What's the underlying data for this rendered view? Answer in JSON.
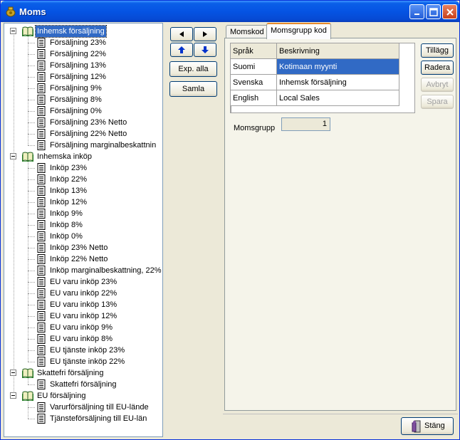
{
  "window": {
    "title": "Moms",
    "icon": "money-bag-icon"
  },
  "tree": {
    "groups": [
      {
        "label": "Inhemsk försäljning",
        "selected": true,
        "items": [
          "Försäljning 23%",
          "Försäljning 22%",
          "Försäljning 13%",
          "Försäljning 12%",
          "Försäljning 9%",
          "Försäljning 8%",
          "Försäljning 0%",
          "Försäljning 23% Netto",
          "Försäljning 22% Netto",
          "Försäljning marginalbeskattnin"
        ]
      },
      {
        "label": "Inhemska inköp",
        "items": [
          "Inköp 23%",
          "Inköp 22%",
          "Inköp 13%",
          "Inköp 12%",
          "Inköp 9%",
          "Inköp 8%",
          "Inköp 0%",
          "Inköp 23% Netto",
          "Inköp 22% Netto",
          "Inköp marginalbeskattning, 22%",
          "EU varu inköp 23%",
          "EU varu inköp 22%",
          "EU varu inköp 13%",
          "EU varu inköp 12%",
          "EU varu inköp 9%",
          "EU varu inköp 8%",
          "EU tjänste inköp 23%",
          "EU tjänste inköp 22%"
        ]
      },
      {
        "label": "Skattefri försäljning",
        "items": [
          "Skattefri försäljning"
        ]
      },
      {
        "label": "EU försäljning",
        "items": [
          "Varurförsäljning till EU-lände",
          "Tjänsteförsäljning till EU-län"
        ]
      }
    ]
  },
  "middle": {
    "expand_all": "Exp. alla",
    "collapse": "Samla"
  },
  "tabs": [
    {
      "label": "Momskod"
    },
    {
      "label": "Momsgrupp kod",
      "active": true
    }
  ],
  "grid": {
    "columns": [
      "Språk",
      "Beskrivning"
    ],
    "rows": [
      {
        "lang": "Suomi",
        "desc": "Kotimaan myynti",
        "selected": true
      },
      {
        "lang": "Svenska",
        "desc": "Inhemsk försäljning"
      },
      {
        "lang": "English",
        "desc": "Local Sales"
      }
    ]
  },
  "side_buttons": {
    "add": "Tillägg",
    "delete": "Radera",
    "cancel": "Avbryt",
    "save": "Spara"
  },
  "momsgrupp": {
    "label": "Momsgrupp",
    "value": "1"
  },
  "close_button": {
    "label": "Stäng",
    "icon": "door-exit-icon"
  },
  "colors": {
    "selection": "#316ac5",
    "titlebar": "#0554e3",
    "tab_highlight": "#e68b2c"
  }
}
